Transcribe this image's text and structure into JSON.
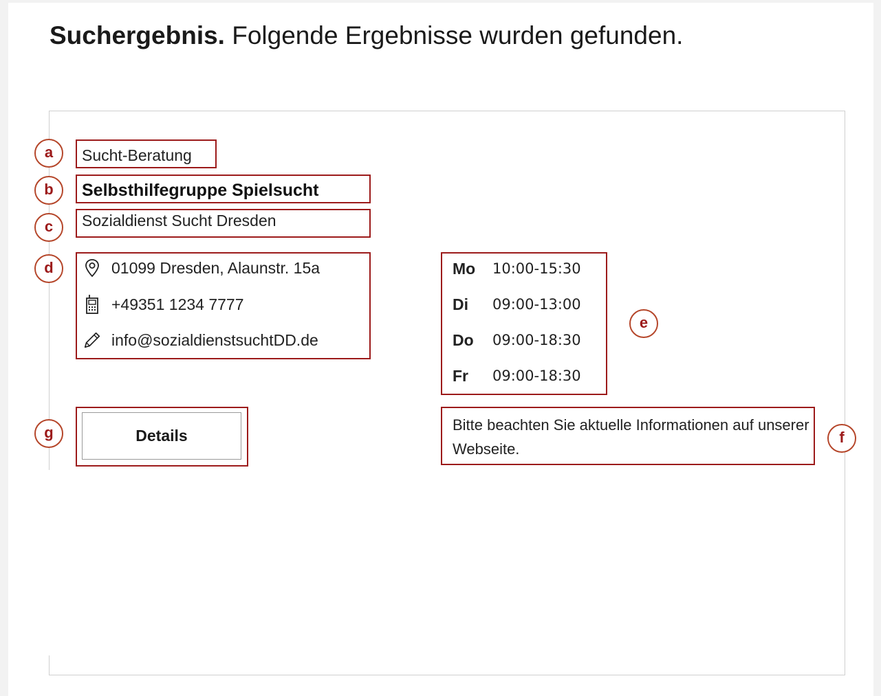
{
  "heading": {
    "bold": "Suchergebnis.",
    "rest": "Folgende Ergebnisse wurden gefunden."
  },
  "result": {
    "category": "Sucht-Beratung",
    "title": "Selbsthilfegruppe Spielsucht",
    "provider": "Sozialdienst Sucht Dresden",
    "contact": {
      "address": "01099 Dresden, Alaunstr. 15a",
      "phone": "+49351 1234 7777",
      "email": "info@sozialdienstsuchtDD.de"
    },
    "hours": [
      {
        "day": "Mo",
        "time": "10:00-15:30"
      },
      {
        "day": "Di",
        "time": "09:00-13:00"
      },
      {
        "day": "Do",
        "time": "09:00-18:30"
      },
      {
        "day": "Fr",
        "time": "09:00-18:30"
      }
    ],
    "details_label": "Details",
    "notice": "Bitte beachten Sie aktuelle Informationen auf unserer Webseite."
  },
  "annotations": {
    "a": "a",
    "b": "b",
    "c": "c",
    "d": "d",
    "e": "e",
    "f": "f",
    "g": "g"
  },
  "colors": {
    "annotation_border": "#9c1a1a",
    "annotation_circle": "#b5462a"
  },
  "icons": {
    "address": "map-pin-icon",
    "phone": "phone-icon",
    "email": "pencil-icon"
  }
}
